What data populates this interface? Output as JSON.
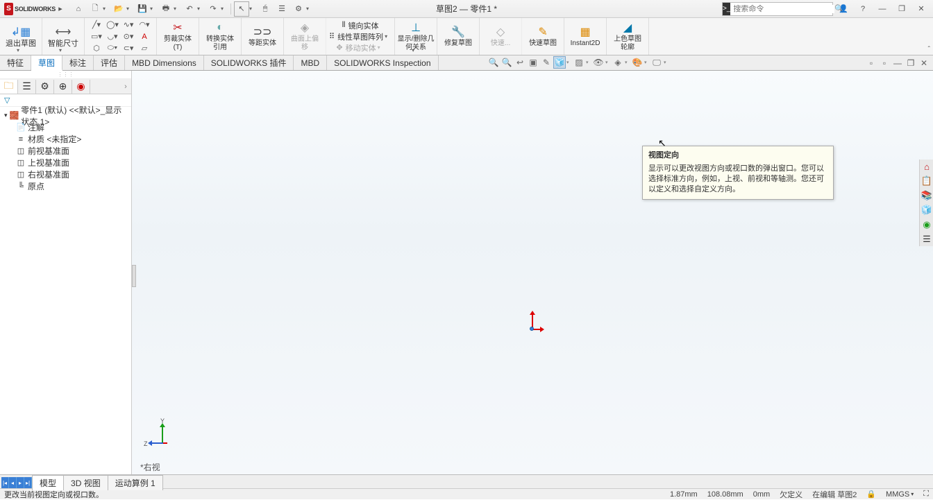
{
  "title_bar": {
    "logo_text": "SOLIDWORKS",
    "doc_title": "草图2 — 零件1 *",
    "search_placeholder": "搜索命令"
  },
  "ribbon": {
    "exit_sketch": "退出草图",
    "smart_dim": "智能尺寸",
    "trim_entity": "剪裁实体(T)",
    "convert_entity": "转换实体引用",
    "offset_entity": "等距实体",
    "surface_offset": "曲面上偏移",
    "mirror_entity": "镜向实体",
    "linear_pattern": "线性草图阵列",
    "move_entity": "移动实体",
    "display_relations": "显示/删除几何关系",
    "repair_sketch": "修复草图",
    "rapid": "快速...",
    "rapid_sketch": "快速草图",
    "instant2d": "Instant2D",
    "shaded_sketch": "上色草图轮廓"
  },
  "tabs": {
    "items": [
      "特征",
      "草图",
      "标注",
      "评估",
      "MBD Dimensions",
      "SOLIDWORKS 插件",
      "MBD",
      "SOLIDWORKS Inspection"
    ],
    "active_index": 1
  },
  "tree": {
    "root": "零件1 (默认) <<默认>_显示状态 1>",
    "nodes": [
      {
        "icon": "📄",
        "label": "注解"
      },
      {
        "icon": "≡",
        "label": "材质 <未指定>"
      },
      {
        "icon": "◫",
        "label": "前视基准面"
      },
      {
        "icon": "◫",
        "label": "上视基准面"
      },
      {
        "icon": "◫",
        "label": "右视基准面"
      },
      {
        "icon": "⌖",
        "label": "原点"
      }
    ]
  },
  "tooltip": {
    "title": "视图定向",
    "body": "显示可以更改视图方向或视口数的弹出窗口。您可以选择标准方向，例如，上视、前视和等轴测。您还可以定义和选择自定义方向。"
  },
  "view_label": "*右视",
  "bottom_tabs": [
    "模型",
    "3D 视图",
    "运动算例 1"
  ],
  "status": {
    "hint": "更改当前视图定向或视口数。",
    "coord1": "1.87mm",
    "coord2": "108.08mm",
    "coord3": "0mm",
    "under": "欠定义",
    "editing": "在编辑 草图2",
    "units": "MMGS"
  }
}
